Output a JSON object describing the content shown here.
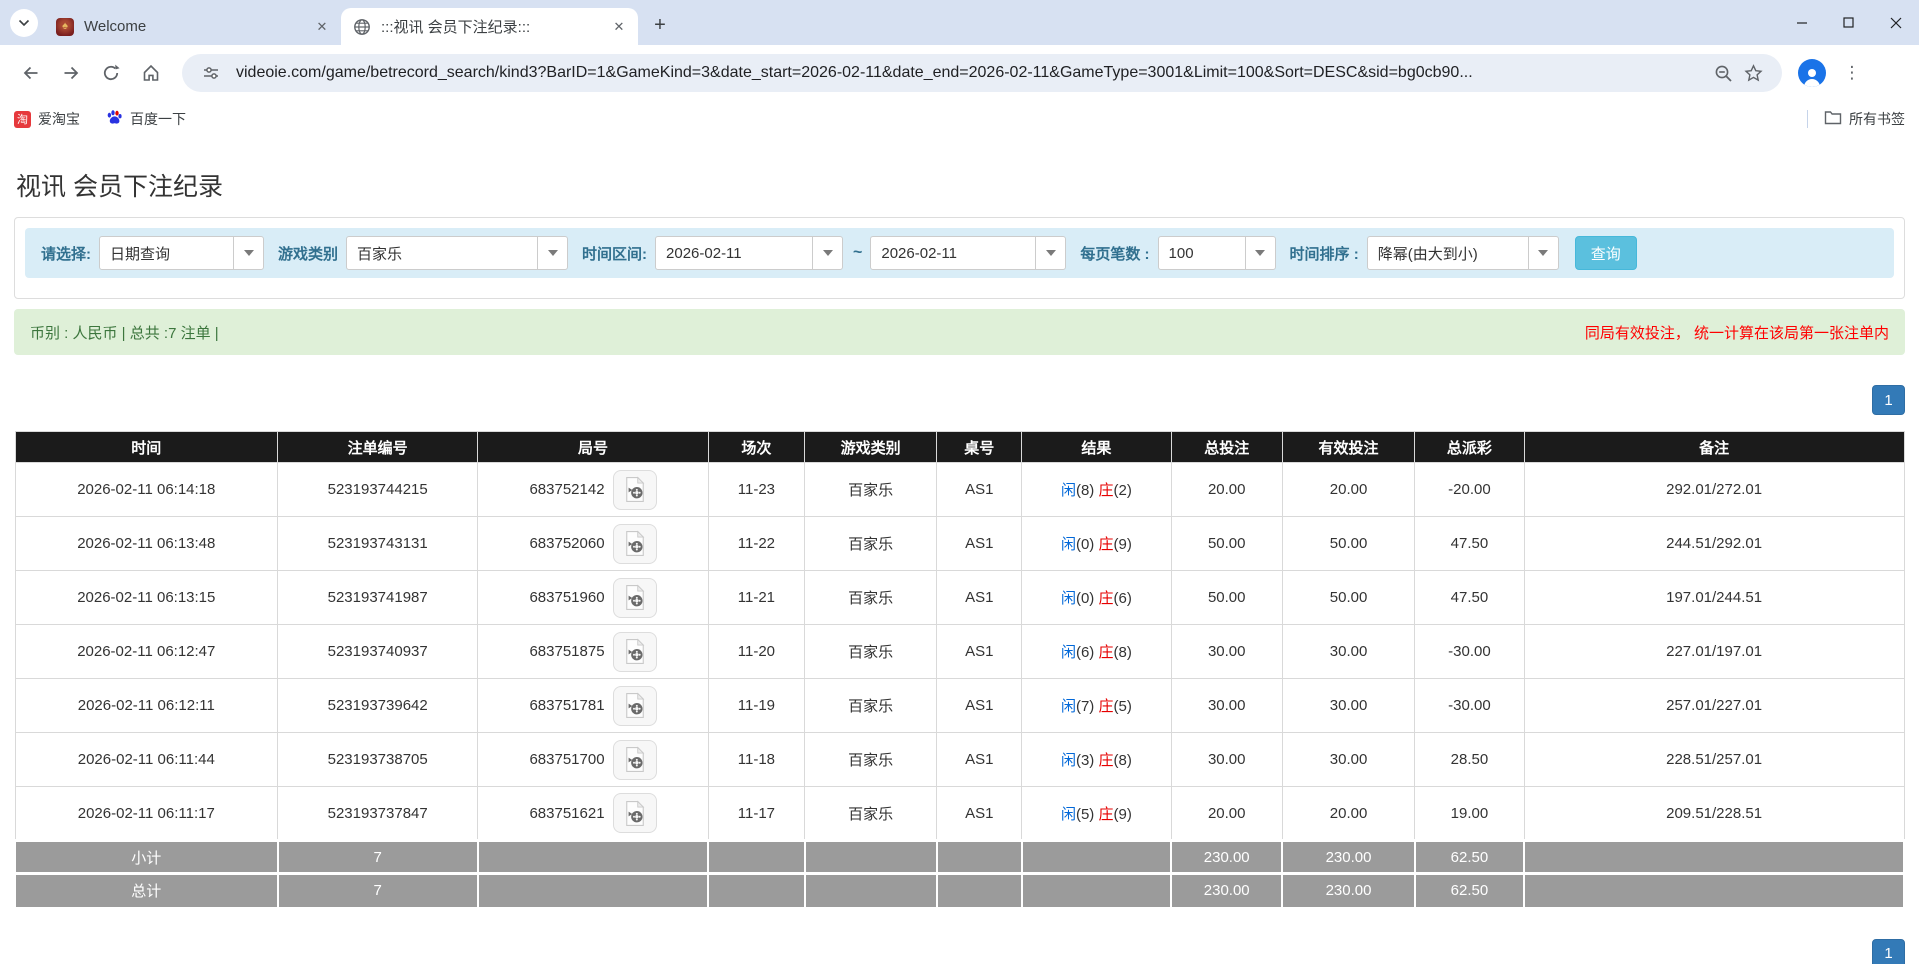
{
  "browser": {
    "tabs": [
      {
        "title": "Welcome"
      },
      {
        "title": ":::视讯 会员下注纪录:::"
      }
    ],
    "url": "videoie.com/game/betrecord_search/kind3?BarID=1&GameKind=3&date_start=2026-02-11&date_end=2026-02-11&GameType=3001&Limit=100&Sort=DESC&sid=bg0cb90...",
    "bookmarks": [
      "爱淘宝",
      "百度一下"
    ],
    "bookmarks_right": "所有书签"
  },
  "page": {
    "title": "视讯 会员下注纪录",
    "filters": {
      "select_label": "请选择:",
      "select_value": "日期查询",
      "game_kind_label": "游戏类别",
      "game_kind_value": "百家乐",
      "date_range_label": "时间区间:",
      "date_start": "2026-02-11",
      "date_tilde": "~",
      "date_end": "2026-02-11",
      "per_page_label": "每页笔数 :",
      "per_page_value": "100",
      "sort_label": "时间排序 :",
      "sort_value": "降幂(由大到小)",
      "search_button": "查询"
    },
    "summary": {
      "left": "币别 : 人民币 | 总共 :7 注单 |",
      "right": "同局有效投注， 统一计算在该局第一张注单内"
    },
    "pagination": {
      "page": "1"
    },
    "table": {
      "headers": [
        "时间",
        "注单编号",
        "局号",
        "场次",
        "游戏类别",
        "桌号",
        "结果",
        "总投注",
        "有效投注",
        "总派彩",
        "备注"
      ],
      "col_widths_pct": [
        13.9,
        10.6,
        12.2,
        5.1,
        7.0,
        4.5,
        7.9,
        5.9,
        7.0,
        5.8,
        20.1
      ],
      "rows": [
        {
          "time": "2026-02-11 06:14:18",
          "bet_id": "523193744215",
          "round": "683752142",
          "session": "11-23",
          "game": "百家乐",
          "table_no": "AS1",
          "result": {
            "player_label": "闲",
            "player_num": "(8)",
            "banker_label": "庄",
            "banker_num": "(2)"
          },
          "total_bet": "20.00",
          "valid_bet": "20.00",
          "payout": "-20.00",
          "remark": "292.01/272.01"
        },
        {
          "time": "2026-02-11 06:13:48",
          "bet_id": "523193743131",
          "round": "683752060",
          "session": "11-22",
          "game": "百家乐",
          "table_no": "AS1",
          "result": {
            "player_label": "闲",
            "player_num": "(0)",
            "banker_label": "庄",
            "banker_num": "(9)"
          },
          "total_bet": "50.00",
          "valid_bet": "50.00",
          "payout": "47.50",
          "remark": "244.51/292.01"
        },
        {
          "time": "2026-02-11 06:13:15",
          "bet_id": "523193741987",
          "round": "683751960",
          "session": "11-21",
          "game": "百家乐",
          "table_no": "AS1",
          "result": {
            "player_label": "闲",
            "player_num": "(0)",
            "banker_label": "庄",
            "banker_num": "(6)"
          },
          "total_bet": "50.00",
          "valid_bet": "50.00",
          "payout": "47.50",
          "remark": "197.01/244.51"
        },
        {
          "time": "2026-02-11 06:12:47",
          "bet_id": "523193740937",
          "round": "683751875",
          "session": "11-20",
          "game": "百家乐",
          "table_no": "AS1",
          "result": {
            "player_label": "闲",
            "player_num": "(6)",
            "banker_label": "庄",
            "banker_num": "(8)"
          },
          "total_bet": "30.00",
          "valid_bet": "30.00",
          "payout": "-30.00",
          "remark": "227.01/197.01"
        },
        {
          "time": "2026-02-11 06:12:11",
          "bet_id": "523193739642",
          "round": "683751781",
          "session": "11-19",
          "game": "百家乐",
          "table_no": "AS1",
          "result": {
            "player_label": "闲",
            "player_num": "(7)",
            "banker_label": "庄",
            "banker_num": "(5)"
          },
          "total_bet": "30.00",
          "valid_bet": "30.00",
          "payout": "-30.00",
          "remark": "257.01/227.01"
        },
        {
          "time": "2026-02-11 06:11:44",
          "bet_id": "523193738705",
          "round": "683751700",
          "session": "11-18",
          "game": "百家乐",
          "table_no": "AS1",
          "result": {
            "player_label": "闲",
            "player_num": "(3)",
            "banker_label": "庄",
            "banker_num": "(8)"
          },
          "total_bet": "30.00",
          "valid_bet": "30.00",
          "payout": "28.50",
          "remark": "228.51/257.01"
        },
        {
          "time": "2026-02-11 06:11:17",
          "bet_id": "523193737847",
          "round": "683751621",
          "session": "11-17",
          "game": "百家乐",
          "table_no": "AS1",
          "result": {
            "player_label": "闲",
            "player_num": "(5)",
            "banker_label": "庄",
            "banker_num": "(9)"
          },
          "total_bet": "20.00",
          "valid_bet": "20.00",
          "payout": "19.00",
          "remark": "209.51/228.51"
        }
      ],
      "subtotal": {
        "label": "小计",
        "count": "7",
        "total_bet": "230.00",
        "valid_bet": "230.00",
        "payout": "62.50"
      },
      "total": {
        "label": "总计",
        "count": "7",
        "total_bet": "230.00",
        "valid_bet": "230.00",
        "payout": "62.50"
      }
    },
    "colors": {
      "accent_blue": "#337ab7",
      "info_bar_bg": "#d9edf7",
      "success_bar_bg": "#dff0d8",
      "success_text": "#3c763d",
      "alert_red": "#ff0000",
      "amount_blue": "#0067d8",
      "banker_red": "#e60000",
      "query_btn_cyan": "#5bc0de",
      "table_header_bg": "#1b1b1b",
      "sum_row_bg": "#9b9b9b"
    }
  }
}
